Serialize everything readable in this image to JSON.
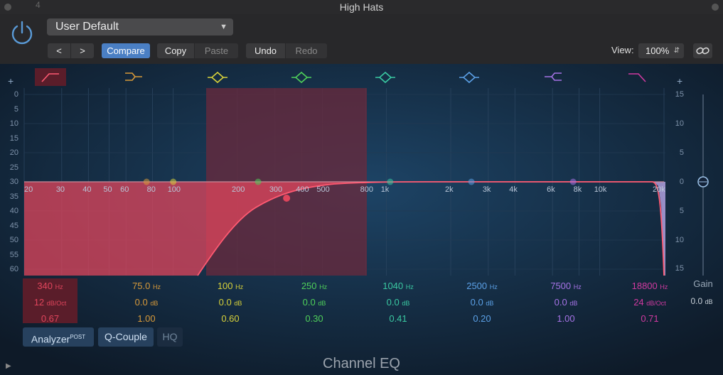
{
  "window": {
    "title": "High Hats",
    "bg_track_number": "4"
  },
  "header": {
    "preset": "User Default",
    "nav_prev": "<",
    "nav_next": ">",
    "compare": "Compare",
    "copy": "Copy",
    "paste": "Paste",
    "undo": "Undo",
    "redo": "Redo",
    "view_label": "View:",
    "zoom": "100%"
  },
  "scale_left": [
    "0",
    "5",
    "10",
    "15",
    "20",
    "25",
    "30",
    "35",
    "40",
    "45",
    "50",
    "55",
    "60"
  ],
  "scale_right": [
    "15",
    "10",
    "5",
    "0",
    "5",
    "10",
    "15"
  ],
  "freq_labels": [
    "20",
    "30",
    "40",
    "50",
    "60",
    "80",
    "100",
    "200",
    "300",
    "400",
    "500",
    "800",
    "1k",
    "2k",
    "3k",
    "4k",
    "6k",
    "8k",
    "10k",
    "20k"
  ],
  "bands": [
    {
      "freq": "340",
      "freq_unit": "Hz",
      "gain": "12",
      "gain_unit": "dB/Oct",
      "q": "0.67",
      "color": "#e0455c",
      "icon": "low-cut-icon"
    },
    {
      "freq": "75.0",
      "freq_unit": "Hz",
      "gain": "0.0",
      "gain_unit": "dB",
      "q": "1.00",
      "color": "#d89a3a",
      "icon": "low-shelf-icon"
    },
    {
      "freq": "100",
      "freq_unit": "Hz",
      "gain": "0.0",
      "gain_unit": "dB",
      "q": "0.60",
      "color": "#d8d23a",
      "icon": "bell-icon"
    },
    {
      "freq": "250",
      "freq_unit": "Hz",
      "gain": "0.0",
      "gain_unit": "dB",
      "q": "0.30",
      "color": "#4fd05a",
      "icon": "bell-icon"
    },
    {
      "freq": "1040",
      "freq_unit": "Hz",
      "gain": "0.0",
      "gain_unit": "dB",
      "q": "0.41",
      "color": "#3ac9a2",
      "icon": "bell-icon"
    },
    {
      "freq": "2500",
      "freq_unit": "Hz",
      "gain": "0.0",
      "gain_unit": "dB",
      "q": "0.20",
      "color": "#5ba0e6",
      "icon": "bell-icon"
    },
    {
      "freq": "7500",
      "freq_unit": "Hz",
      "gain": "0.0",
      "gain_unit": "dB",
      "q": "1.00",
      "color": "#a673e6",
      "icon": "high-shelf-icon"
    },
    {
      "freq": "18800",
      "freq_unit": "Hz",
      "gain": "24",
      "gain_unit": "dB/Oct",
      "q": "0.71",
      "color": "#d03aa0",
      "icon": "high-cut-icon"
    }
  ],
  "gain": {
    "title": "Gain",
    "value": "0.0",
    "unit": "dB"
  },
  "toggles": {
    "analyzer": "Analyzer",
    "analyzer_sup": "POST",
    "qcouple": "Q-Couple",
    "hq": "HQ"
  },
  "plugin_name": "Channel EQ"
}
